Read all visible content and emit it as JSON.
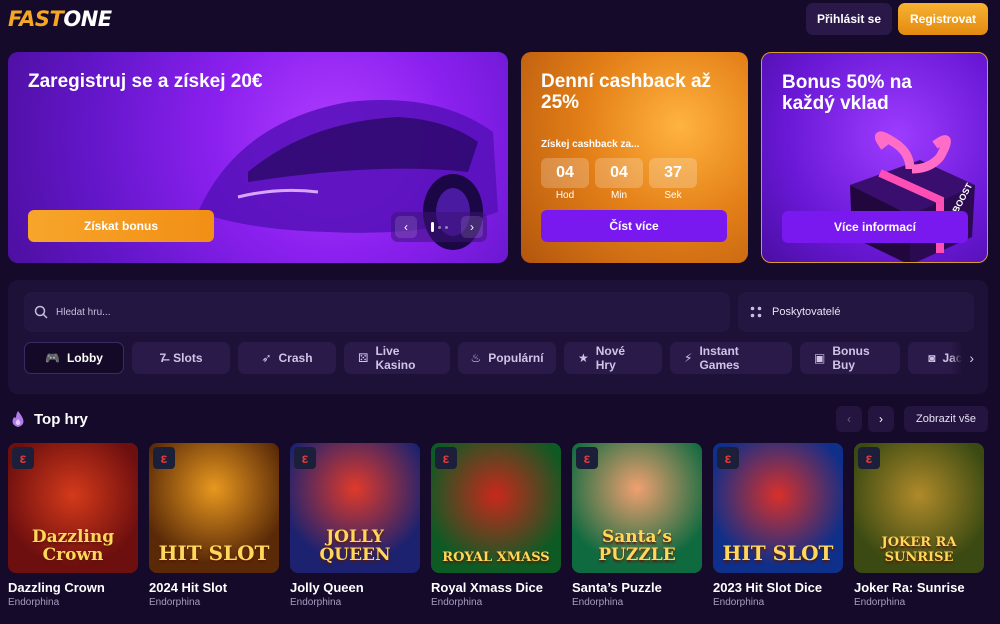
{
  "header": {
    "logo_part1": "FAST",
    "logo_part2": "ONE",
    "login_label": "Přihlásit se",
    "register_label": "Registrovat"
  },
  "banners": [
    {
      "title": "Zaregistruj se a získej 20€",
      "button": "Získat bonus"
    },
    {
      "title": "Denní cashback až 25%",
      "subtitle": "Získej cashback za...",
      "button": "Číst více",
      "countdown": [
        {
          "value": "04",
          "label": "Hod"
        },
        {
          "value": "04",
          "label": "Min"
        },
        {
          "value": "37",
          "label": "Sek"
        }
      ]
    },
    {
      "title": "Bonus 50% na každý vklad",
      "button": "Více informací",
      "gift_text": "NITRO BOOST"
    }
  ],
  "search": {
    "placeholder": "Hledat hru...",
    "providers_label": "Poskytovatelé"
  },
  "tabs": [
    {
      "label": "Lobby",
      "icon": "gamepad-icon",
      "active": true
    },
    {
      "label": "Slots",
      "icon": "slots-icon"
    },
    {
      "label": "Crash",
      "icon": "rocket-icon"
    },
    {
      "label": "Live Kasino",
      "icon": "dice-icon"
    },
    {
      "label": "Populární",
      "icon": "fire-icon"
    },
    {
      "label": "Nové Hry",
      "icon": "star-icon"
    },
    {
      "label": "Instant Games",
      "icon": "lightning-icon"
    },
    {
      "label": "Bonus Buy",
      "icon": "ticket-icon"
    },
    {
      "label": "Jackpot",
      "icon": "jackpot-icon"
    }
  ],
  "top_games": {
    "title": "Top hry",
    "show_all": "Zobrazit vše",
    "games": [
      {
        "name": "Dazzling Crown",
        "provider": "Endorphina",
        "art_text": "Dazzling Crown",
        "bg": "#6e0f0f"
      },
      {
        "name": "2024 Hit Slot",
        "provider": "Endorphina",
        "art_text": "HIT SLOT",
        "bg": "#5a2a08"
      },
      {
        "name": "Jolly Queen",
        "provider": "Endorphina",
        "art_text": "JOLLY QUEEN",
        "bg": "#1c2270"
      },
      {
        "name": "Royal Xmass Dice",
        "provider": "Endorphina",
        "art_text": "ROYAL XMASS",
        "bg": "#0e5a24"
      },
      {
        "name": "Santa’s Puzzle",
        "provider": "Endorphina",
        "art_text": "Santa’s PUZZLE",
        "bg": "#0f6a40"
      },
      {
        "name": "2023 Hit Slot Dice",
        "provider": "Endorphina",
        "art_text": "HIT SLOT",
        "bg": "#0e2f8a"
      },
      {
        "name": "Joker Ra: Sunrise",
        "provider": "Endorphina",
        "art_text": "JOKER RA SUNRISE",
        "bg": "#3a4a12"
      }
    ]
  }
}
